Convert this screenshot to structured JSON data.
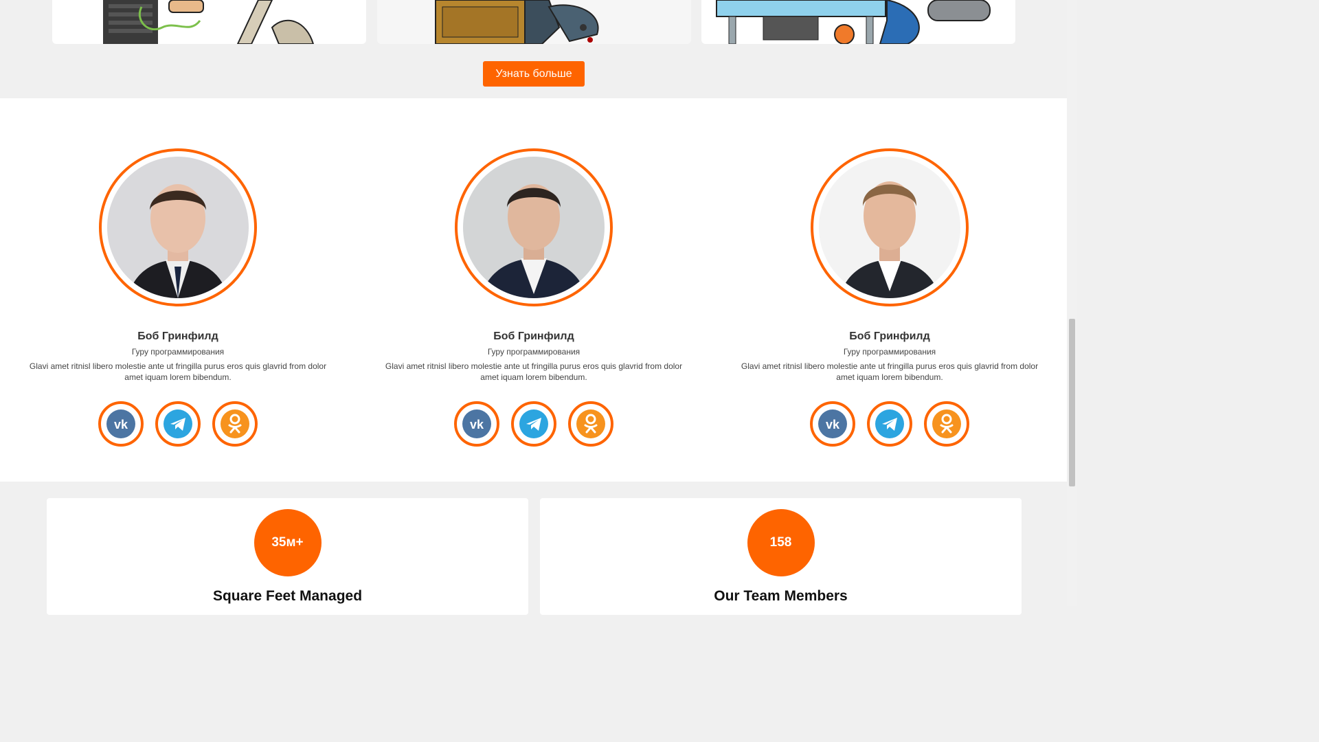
{
  "top": {
    "learn_more_label": "Узнать больше",
    "accent": "#fe6400"
  },
  "team": {
    "members": [
      {
        "name": "Боб Гринфилд",
        "role": "Гуру программирования",
        "bio": "Glavi amet ritnisl libero molestie ante ut fringilla purus eros quis glavrid from dolor amet iquam lorem bibendum.",
        "socials": [
          "vk-icon",
          "telegram-icon",
          "odnoklassniki-icon"
        ]
      },
      {
        "name": "Боб Гринфилд",
        "role": "Гуру программирования",
        "bio": "Glavi amet ritnisl libero molestie ante ut fringilla purus eros quis glavrid from dolor amet iquam lorem bibendum.",
        "socials": [
          "vk-icon",
          "telegram-icon",
          "odnoklassniki-icon"
        ]
      },
      {
        "name": "Боб Гринфилд",
        "role": "Гуру программирования",
        "bio": "Glavi amet ritnisl libero molestie ante ut fringilla purus eros quis glavrid from dolor amet iquam lorem bibendum.",
        "socials": [
          "vk-icon",
          "telegram-icon",
          "odnoklassniki-icon"
        ]
      }
    ]
  },
  "stats": [
    {
      "value": "35м+",
      "label": "Square Feet Managed"
    },
    {
      "value": "158",
      "label": "Our Team Members"
    }
  ],
  "colors": {
    "accent": "#fe6400",
    "vk": "#4c75a3",
    "telegram": "#2ca5e0",
    "odnoklassniki": "#f7931e"
  }
}
